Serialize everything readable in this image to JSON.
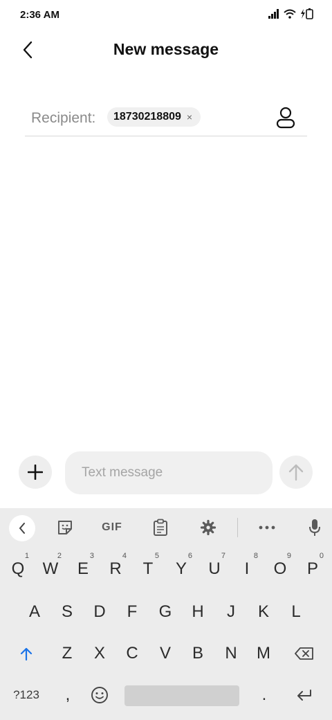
{
  "status": {
    "time": "2:36 AM"
  },
  "header": {
    "title": "New message"
  },
  "recipient": {
    "label": "Recipient:",
    "chip_number": "18730218809",
    "chip_close": "×"
  },
  "compose": {
    "placeholder": "Text message"
  },
  "keyboard": {
    "toolbar": {
      "gif_label": "GIF"
    },
    "row1": [
      {
        "key": "Q",
        "num": "1"
      },
      {
        "key": "W",
        "num": "2"
      },
      {
        "key": "E",
        "num": "3"
      },
      {
        "key": "R",
        "num": "4"
      },
      {
        "key": "T",
        "num": "5"
      },
      {
        "key": "Y",
        "num": "6"
      },
      {
        "key": "U",
        "num": "7"
      },
      {
        "key": "I",
        "num": "8"
      },
      {
        "key": "O",
        "num": "9"
      },
      {
        "key": "P",
        "num": "0"
      }
    ],
    "row2": [
      "A",
      "S",
      "D",
      "F",
      "G",
      "H",
      "J",
      "K",
      "L"
    ],
    "row3": [
      "Z",
      "X",
      "C",
      "V",
      "B",
      "N",
      "M"
    ],
    "bottom": {
      "symbols": "?123",
      "comma": ",",
      "period": "."
    }
  },
  "colors": {
    "accent": "#1a73e8",
    "background": "#ffffff",
    "keyboard_bg": "#ececec"
  }
}
